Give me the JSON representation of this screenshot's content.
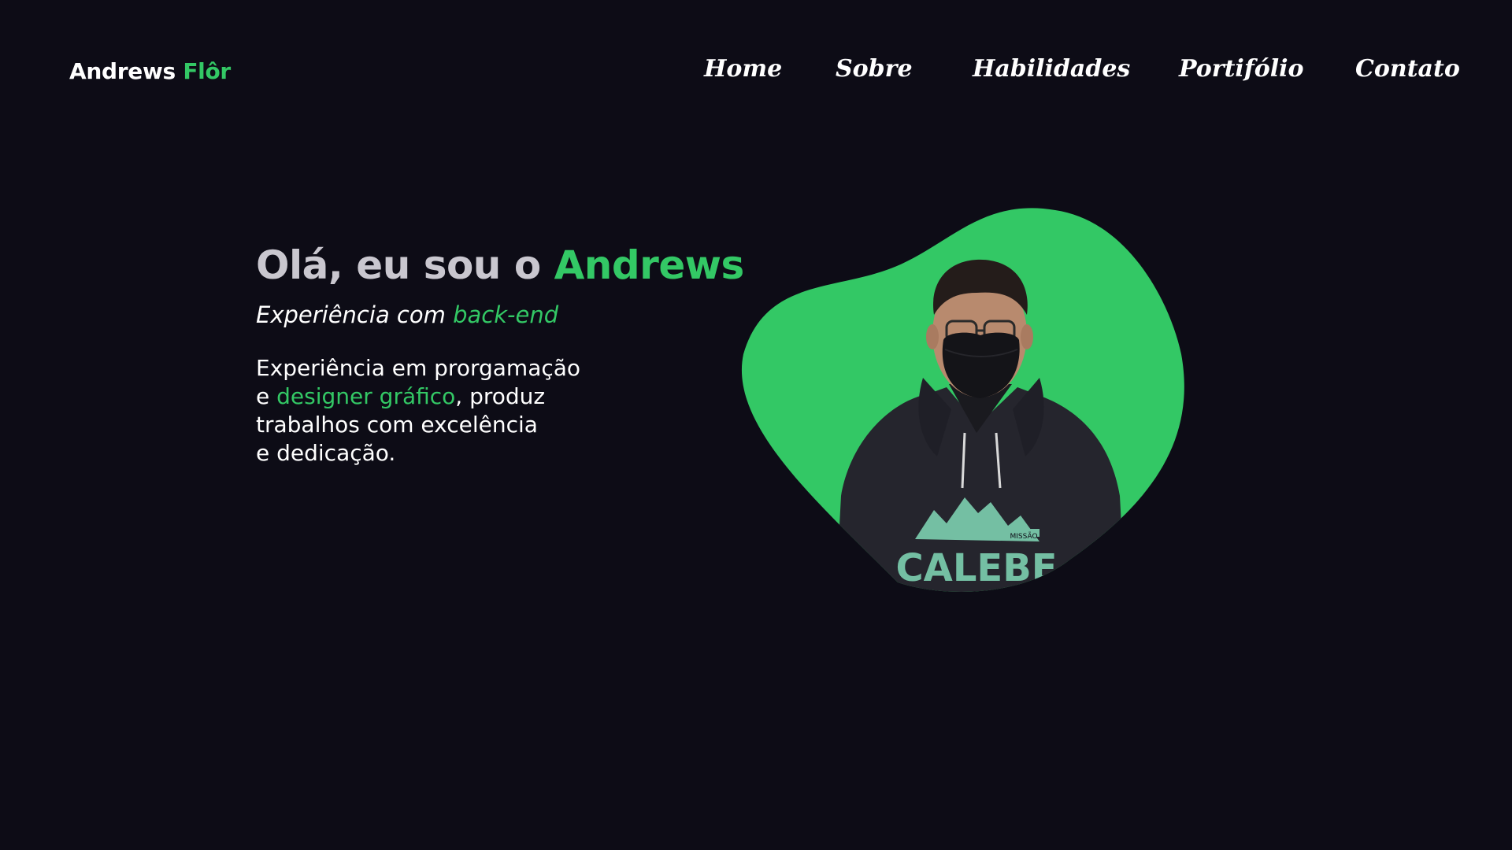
{
  "header": {
    "logo_first": "Andrews",
    "logo_second": "Flôr",
    "nav": [
      {
        "label": "Home"
      },
      {
        "label": "Sobre"
      },
      {
        "label": "Habilidades"
      },
      {
        "label": "Portifólio"
      },
      {
        "label": "Contato"
      }
    ]
  },
  "hero": {
    "title_prefix": "Olá, eu sou o",
    "title_name": "Andrews",
    "subtitle_prefix": "Experiência com",
    "subtitle_accent": "back-end",
    "desc_line1": "Experiência em prorgamação",
    "desc_line2_prefix": "e ",
    "desc_line2_accent": "designer gráfico",
    "desc_line2_suffix": ", produz",
    "desc_line3": "trabalhos com excelência",
    "desc_line4": "e dedicação.",
    "shirt_text": "CALEBE",
    "shirt_small_text": "MISSÃO"
  },
  "colors": {
    "background": "#0d0c16",
    "accent": "#33c865",
    "text": "#ffffff",
    "title_muted": "#c9c7cf"
  }
}
